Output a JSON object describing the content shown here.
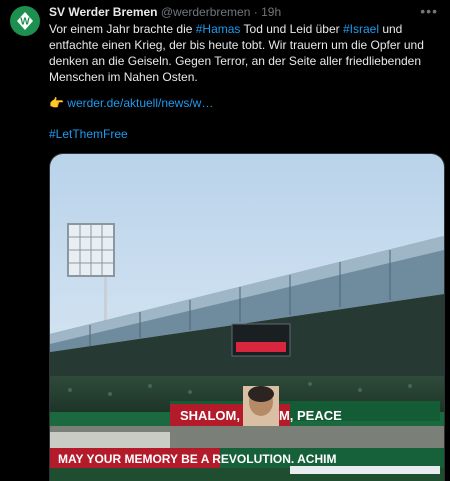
{
  "tweet": {
    "author_name": "SV Werder Bremen",
    "handle": "@werderbremen",
    "separator": "·",
    "time": "19h",
    "text_part1": "Vor einem Jahr brachte die ",
    "tag_hamas": "#Hamas",
    "text_part2": " Tod und Leid über ",
    "tag_israel": "#Israel",
    "text_part3": " und entfachte einen Krieg, der bis heute tobt. Wir trauern um die Opfer und denken an die Geiseln. Gegen Terror, an der Seite aller friedliebenden Menschen im Nahen Osten.",
    "link_prefix": "👉 ",
    "link_text": "werder.de/aktuell/news/w…",
    "hashtag_line": "#LetThemFree"
  },
  "media": {
    "banner_upper": "SHALOM, SALAM, PEACE",
    "banner_lower": "MAY YOUR MEMORY BE A REVOLUTION. ACHIM"
  },
  "colors": {
    "link": "#1d9bf0",
    "background": "#000000",
    "club_green": "#1d8f4f"
  },
  "icons": {
    "avatar": "werder-diamond-logo",
    "more": "more-horizontal-icon"
  }
}
